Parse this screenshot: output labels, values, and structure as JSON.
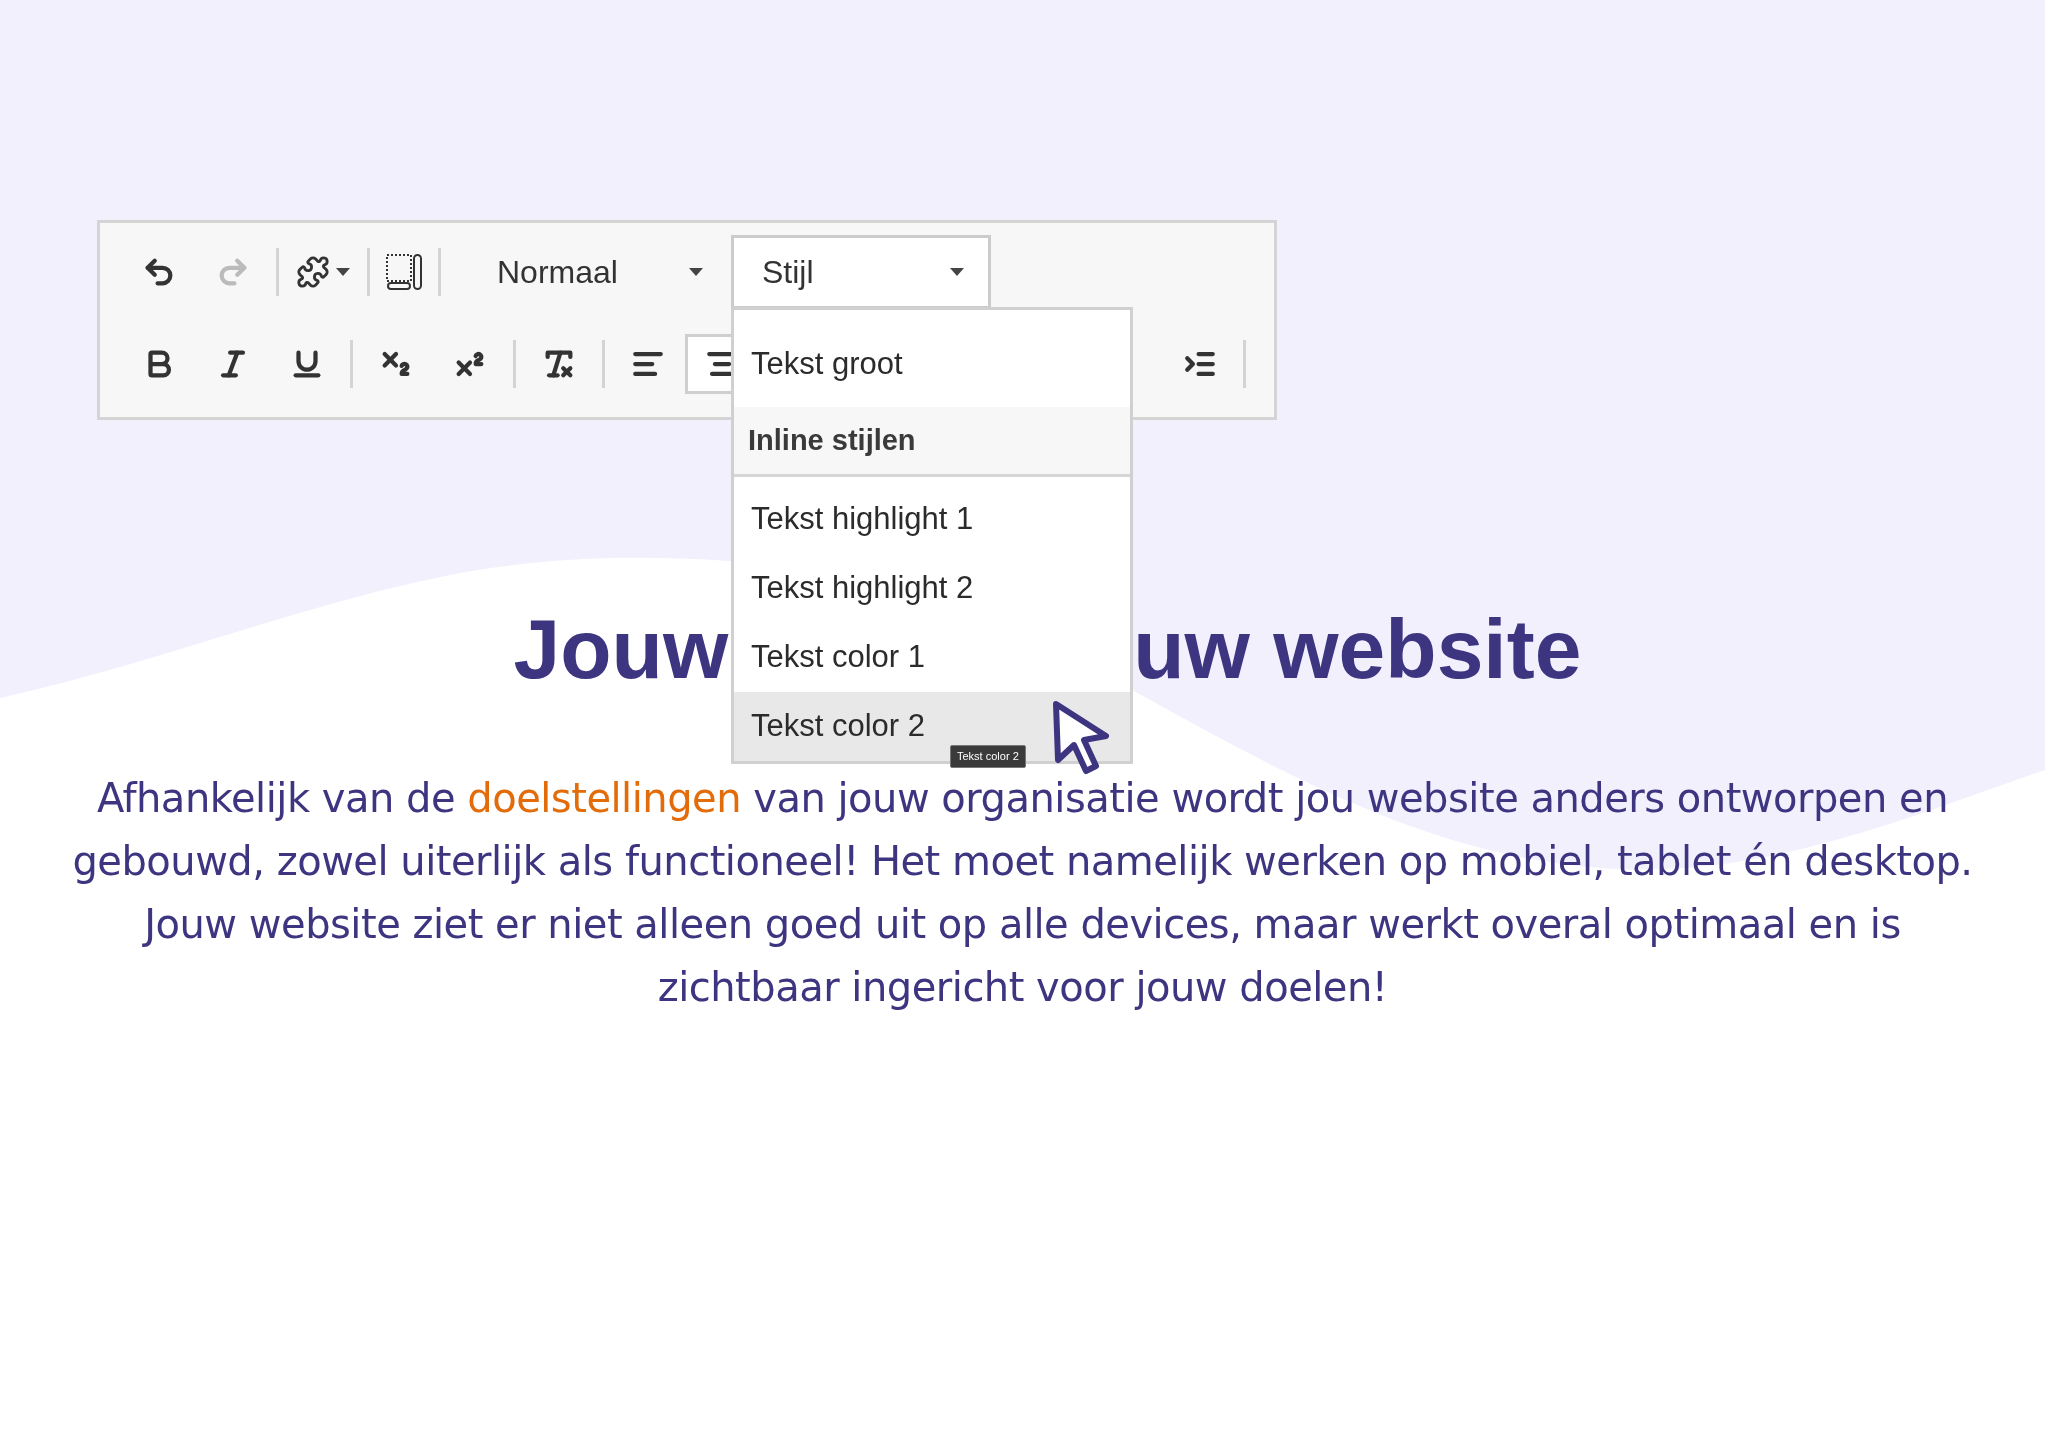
{
  "toolbar": {
    "row1": [
      {
        "kind": "undo"
      },
      {
        "kind": "redo",
        "disabled": true
      },
      {
        "kind": "separator"
      },
      {
        "kind": "plugins"
      },
      {
        "kind": "separator"
      },
      {
        "kind": "templates"
      },
      {
        "kind": "separator"
      },
      {
        "kind": "format",
        "label": "Normaal"
      }
    ],
    "style_dropdown": {
      "label": "Stijl",
      "expanded": true,
      "items": [
        {
          "kind": "item",
          "label": "Tekst groot",
          "selected": false
        },
        {
          "kind": "header",
          "label": "Inline stijlen"
        },
        {
          "kind": "item",
          "label": "Tekst highlight 1",
          "selected": false
        },
        {
          "kind": "item",
          "label": "Tekst highlight 2",
          "selected": false
        },
        {
          "kind": "item",
          "label": "Tekst color 1",
          "selected": false
        },
        {
          "kind": "item",
          "label": "Tekst color 2",
          "selected": true
        }
      ]
    },
    "tooltip": "Tekst color 2",
    "row2": [
      {
        "kind": "bold",
        "selected": false
      },
      {
        "kind": "italic",
        "selected": false
      },
      {
        "kind": "underline",
        "selected": false
      },
      {
        "kind": "separator"
      },
      {
        "kind": "subscript",
        "selected": false
      },
      {
        "kind": "superscript",
        "selected": false
      },
      {
        "kind": "separator"
      },
      {
        "kind": "clear-format",
        "selected": false
      },
      {
        "kind": "separator"
      },
      {
        "kind": "align-left",
        "selected": false
      },
      {
        "kind": "align-center",
        "selected": true
      }
    ],
    "row2_end": [
      {
        "kind": "indent",
        "selected": false
      },
      {
        "kind": "separator"
      }
    ]
  },
  "heading": {
    "left": "Jouw",
    "right": "uw website"
  },
  "paragraph": "Afhankelijk van de **doelstellingen** van jouw organisatie wordt jou website anders ontworpen en gebouwd, zowel uiterlijk als functioneel! Het moet namelijk werken op mobiel, tablet én desktop. Jouw website ziet er niet alleen goed uit op alle devices, maar werkt overal optimaal en is zichtbaar ingericht voor jouw doelen!"
}
